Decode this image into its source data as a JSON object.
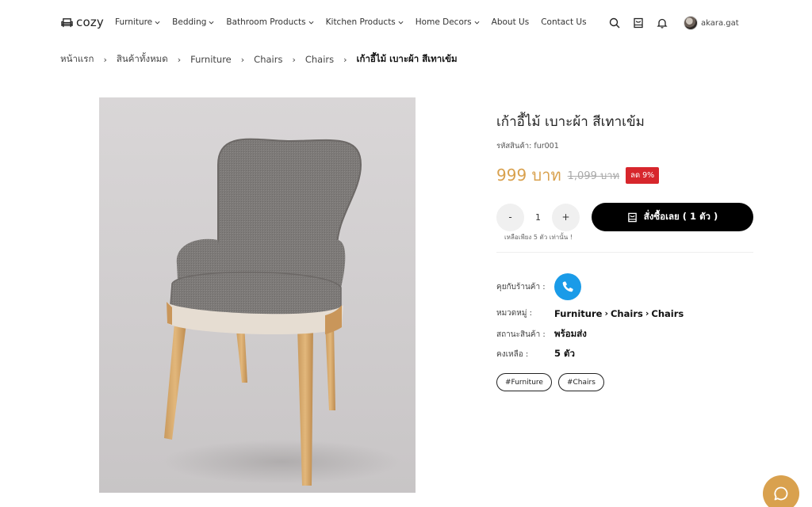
{
  "brand": {
    "name": "cozy"
  },
  "nav": {
    "items": [
      {
        "label": "Furniture",
        "dropdown": true
      },
      {
        "label": "Bedding",
        "dropdown": true
      },
      {
        "label": "Bathroom Products",
        "dropdown": true
      },
      {
        "label": "Kitchen Products",
        "dropdown": true
      },
      {
        "label": "Home Decors",
        "dropdown": true
      },
      {
        "label": "About Us",
        "dropdown": false
      },
      {
        "label": "Contact Us",
        "dropdown": false
      }
    ],
    "icons": [
      "search-icon",
      "cart-icon",
      "bell-icon"
    ],
    "username": "akara.gat"
  },
  "breadcrumb": {
    "items": [
      "หน้าแรก",
      "สินค้าทั้งหมด",
      "Furniture",
      "Chairs",
      "Chairs"
    ],
    "current": "เก้าอี้ไม้ เบาะผ้า สีเทาเข้ม"
  },
  "product": {
    "title": "เก้าอี้ไม้ เบาะผ้า สีเทาเข้ม",
    "sku": "รหัสสินค้า: fur001",
    "price": "999 บาท",
    "old_price": "1,099 บาท",
    "discount": "ลด 9%",
    "quantity": "1",
    "minus_label": "-",
    "plus_label": "+",
    "buy_label": "สั่งซื้อเลย ( 1 ตัว )",
    "stock_note": "เหลือเพียง 5 ตัว เท่านั้น !",
    "contact_label": "คุยกับร้านค้า :",
    "category_label": "หมวดหมู่ :",
    "categories": [
      "Furniture",
      "Chairs",
      "Chairs"
    ],
    "status_label": "สถานะสินค้า :",
    "status": "พร้อมส่ง",
    "remaining_label": "คงเหลือ :",
    "remaining": "5 ตัว",
    "tags": [
      "#Furniture",
      "#Chairs"
    ]
  },
  "colors": {
    "accent": "#d9a14e",
    "discount": "#d7262c",
    "phone": "#1a9be8",
    "buy_button": "#000000"
  }
}
